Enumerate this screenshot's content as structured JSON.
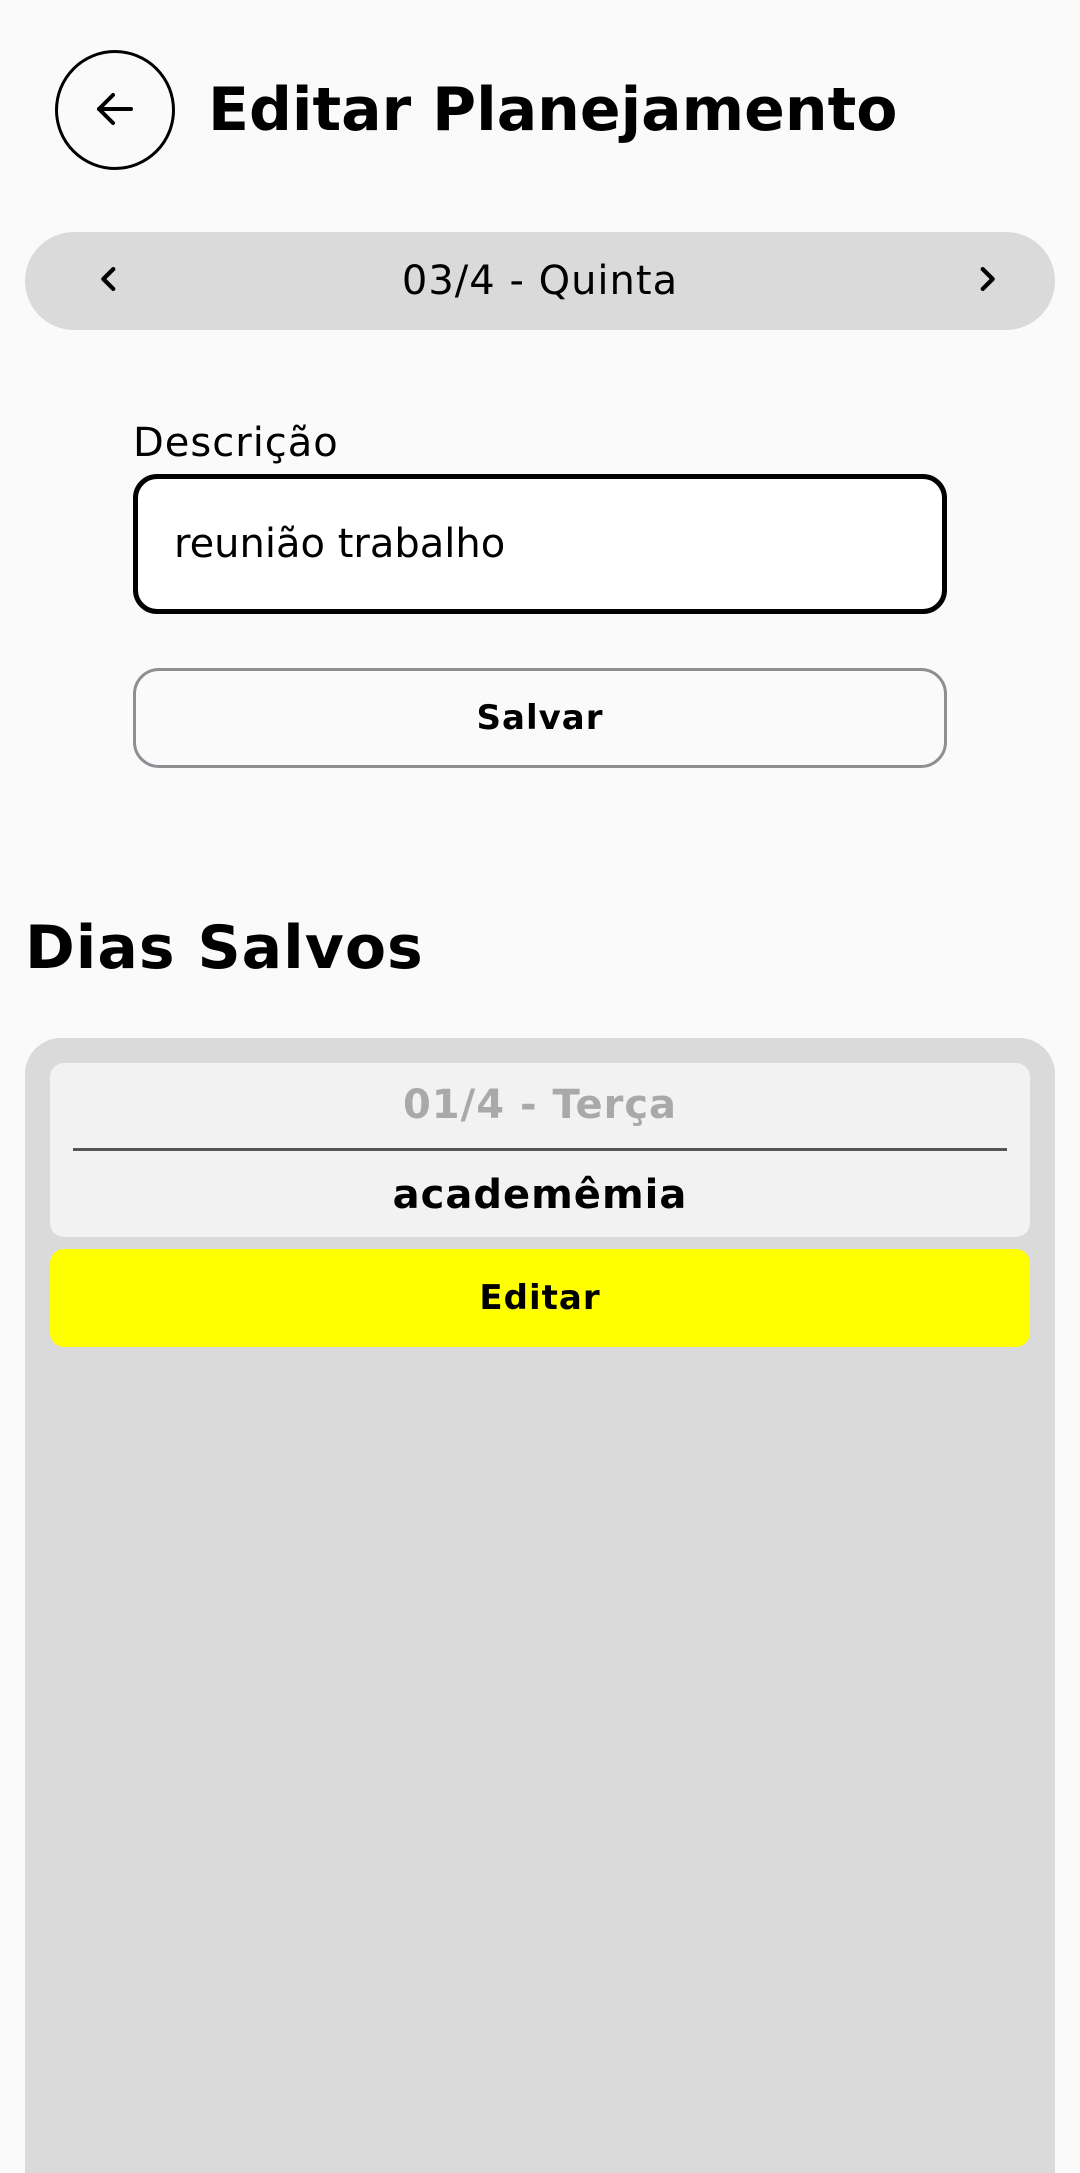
{
  "header": {
    "back_icon": "arrow-left-icon",
    "title": "Editar Planejamento"
  },
  "date_selector": {
    "prev_icon": "chevron-left-icon",
    "label": "03/4 - Quinta",
    "next_icon": "chevron-right-icon"
  },
  "form": {
    "description_label": "Descrição",
    "description_value": "reunião trabalho",
    "save_label": "Salvar"
  },
  "saved_days": {
    "title": "Dias Salvos",
    "items": [
      {
        "date": "01/4 - Terça",
        "description": "academêmia",
        "edit_label": "Editar"
      }
    ]
  },
  "colors": {
    "background": "#fafafa",
    "panel": "#dadada",
    "card": "#f2f2f2",
    "accent_yellow": "#ffff00",
    "muted_text": "#a9a9a9"
  }
}
